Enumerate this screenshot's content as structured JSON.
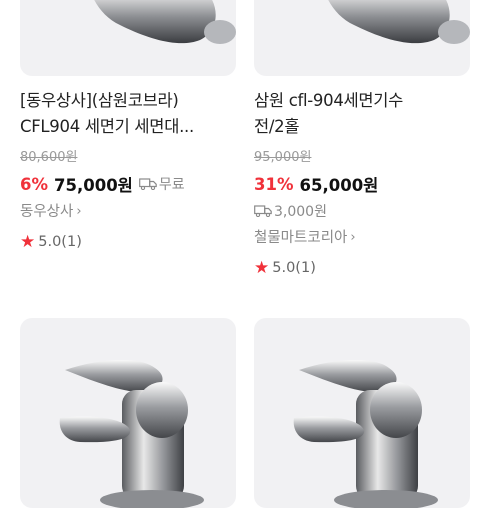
{
  "products": [
    {
      "title_line1": "[동우상사](삼원코브라)",
      "title_line2": "CFL904 세면기 세면대...",
      "original_price": "80,600원",
      "discount": "6%",
      "price": "75,000원",
      "shipping": "무료",
      "seller": "동우상사",
      "rating": "5.0(1)"
    },
    {
      "title_line1": "삼원 cfl-904세면기수",
      "title_line2": "전/2홀",
      "original_price": "95,000원",
      "discount": "31%",
      "price": "65,000원",
      "shipping": "3,000원",
      "seller": "철물마트코리아",
      "rating": "5.0(1)"
    }
  ],
  "icons": {
    "shipping": "truck-icon",
    "star": "star-icon",
    "chevron": "chevron-right-icon"
  },
  "colors": {
    "discount": "#f0313a",
    "star": "#f0313a",
    "thumb_bg": "#f1f1f3"
  }
}
